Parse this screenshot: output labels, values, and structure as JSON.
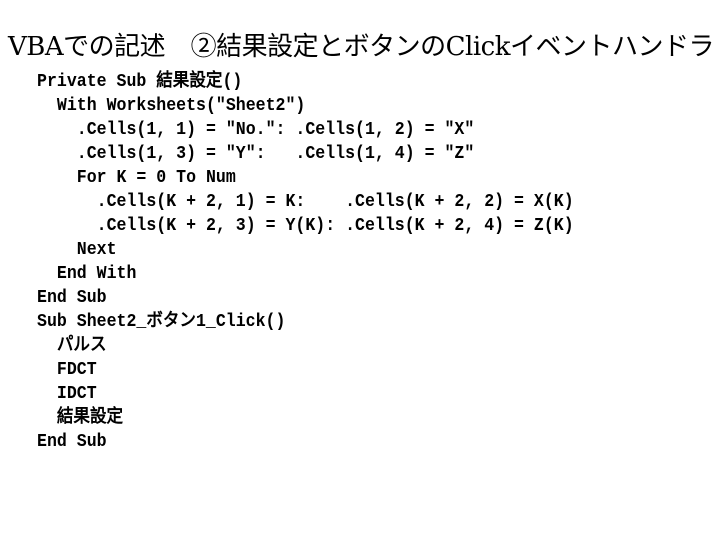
{
  "title": "VBAでの記述　②結果設定とボタンのClickイベントハンドラ",
  "code_lines": [
    "Private Sub 結果設定()",
    "  With Worksheets(\"Sheet2\")",
    "    .Cells(1, 1) = \"No.\": .Cells(1, 2) = \"X\"",
    "    .Cells(1, 3) = \"Y\":   .Cells(1, 4) = \"Z\"",
    "    For K = 0 To Num",
    "      .Cells(K + 2, 1) = K:    .Cells(K + 2, 2) = X(K)",
    "      .Cells(K + 2, 3) = Y(K): .Cells(K + 2, 4) = Z(K)",
    "    Next",
    "  End With",
    "End Sub",
    "Sub Sheet2_ボタン1_Click()",
    "  パルス",
    "  FDCT",
    "  IDCT",
    "  結果設定",
    "End Sub"
  ]
}
